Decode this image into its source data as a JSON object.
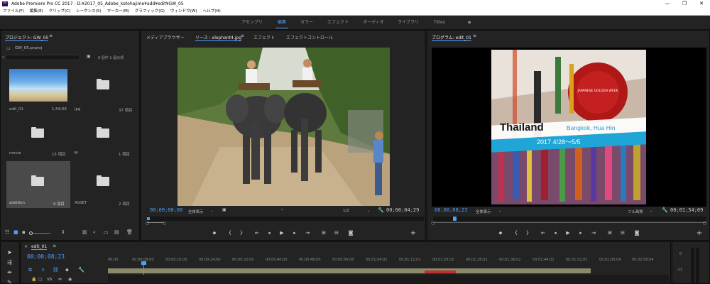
{
  "title_bar": {
    "app_icon": "Pr",
    "title": "Adobe Premiere Pro CC 2017 - D:¥2017_05_Adobe_kotohajime¥add¥edit¥GW_05",
    "minimize": "—",
    "maximize": "❐",
    "close": "✕"
  },
  "menu": [
    "ファイル(F)",
    "編集(E)",
    "クリップ(C)",
    "シーケンス(S)",
    "マーカー(M)",
    "グラフィック(G)",
    "ウィンドウ(W)",
    "ヘルプ(H)"
  ],
  "workspaces": {
    "items": [
      "アセンブリ",
      "編集",
      "カラー",
      "エフェクト",
      "オーディオ",
      "ライブラリ",
      "Titles"
    ],
    "active": "編集",
    "more": "»"
  },
  "project": {
    "title": "プロジェクト: GW_05",
    "file": "GW_05.prproj",
    "count": "6 個中 1 個の項",
    "items": [
      {
        "name": "edit_01",
        "meta": "1;54;09"
      },
      {
        "name": "jpg",
        "meta": "37 項目"
      },
      {
        "name": "movie",
        "meta": "15 項目"
      },
      {
        "name": "M",
        "meta": "1 項目"
      },
      {
        "name": "addition",
        "meta": "9 項目"
      },
      {
        "name": "ASSET",
        "meta": "2 項目"
      }
    ]
  },
  "source": {
    "tabs": [
      "メディアブラウザー",
      "ソース : elephant4.jpg",
      "エフェクト",
      "エフェクトコントロール"
    ],
    "active_tab": "ソース : elephant4.jpg",
    "timecode": "00;00;00;00",
    "zoom": "全体表示",
    "resolution": "1/2",
    "duration": "00;00;04;29"
  },
  "program": {
    "title": "プログラム: edit_01",
    "timecode": "00;00;08;23",
    "zoom": "全体表示",
    "resolution": "フル画質",
    "duration": "00;01;54;09",
    "overlay": {
      "main": "Thailand",
      "sub": "Bangkok, Hua Hin",
      "date": "2017 4/28～5/5"
    },
    "sign_text": "JAPANESE GOLDEN WEEK"
  },
  "timeline": {
    "tab": "edit_01",
    "timecode": "00;00;08;23",
    "ruler": [
      "00;00",
      "00;00;08;00",
      "00;00;16;00",
      "00;00;24;00",
      "00;00;32;00",
      "00;00;40;00",
      "00;00;48;00",
      "00;00;56;00",
      "00;01;04;02",
      "00;01;12;02",
      "00;01;20;02",
      "00;01;28;02",
      "00;01;36;02",
      "00;01;44;02",
      "00;01;52;02",
      "00;02;00;04",
      "00;02;08;04"
    ],
    "track": "V6",
    "meter_labels": [
      "0",
      "-12"
    ]
  },
  "colors": {
    "accent": "#4ea0ff",
    "panel": "#232323",
    "background": "#1d1d1d",
    "banner_cyan": "#1fa5d6"
  }
}
